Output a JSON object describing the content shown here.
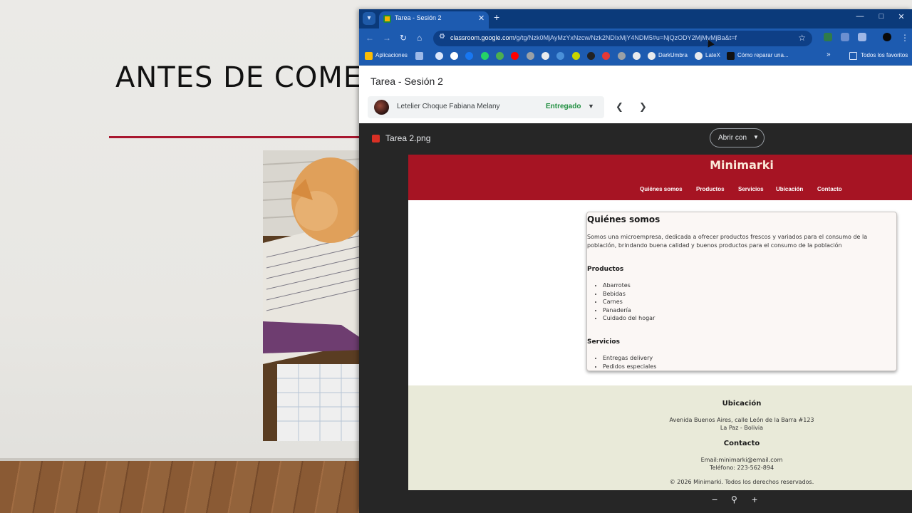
{
  "slide": {
    "title": "ANTES DE COMEN",
    "accent_color": "#a8162e"
  },
  "browser": {
    "tab": {
      "title": "Tarea - Sesión 2"
    },
    "address": {
      "host": "classroom.google.com",
      "path": "/g/tg/Nzk0MjAyMzYxNzcw/Nzk2NDIxMjY4NDM5#u=NjQzODY2MjMyMjBa&t=f"
    },
    "bookmarks": {
      "apps_label": "Aplicaciones",
      "items": [
        "DarkUmbra",
        "LateX",
        "Cómo reparar una..."
      ],
      "all_label": "Todos los favoritos"
    }
  },
  "classroom": {
    "title": "Tarea - Sesión 2",
    "student_name": "Letelier Choque Fabiana Melany",
    "status": "Entregado",
    "file_name": "Tarea 2.png",
    "open_with_label": "Abrir con"
  },
  "minimarki": {
    "brand": "Minimarki",
    "nav": [
      "Quiénes somos",
      "Productos",
      "Servicios",
      "Ubicación",
      "Contacto"
    ],
    "about_title": "Quiénes somos",
    "about_text": "Somos una microempresa, dedicada a ofrecer productos frescos y variados para el consumo de la población, brindando buena calidad y buenos productos para el consumo de la población",
    "products_title": "Productos",
    "products": [
      "Abarrotes",
      "Bebidas",
      "Carnes",
      "Panadería",
      "Cuidado del hogar"
    ],
    "services_title": "Servicios",
    "services": [
      "Entregas delivery",
      "Pedidos especiales"
    ],
    "footer": {
      "location_title": "Ubicación",
      "address_line1": "Avenida Buenos Aires, calle León de la Barra #123",
      "address_line2": "La Paz - Bolivia",
      "contact_title": "Contacto",
      "email": "Email:minimarki@email.com",
      "phone": "Teléfono: 223-562-894",
      "copyright": "© 2026 Minimarki. Todos los derechos reservados."
    },
    "colors": {
      "header": "#a61423",
      "footer": "#e9ead9"
    }
  },
  "icons": {
    "tab_menu": "chevron-down-icon",
    "back": "arrow-left-icon",
    "forward": "arrow-right-icon",
    "reload": "reload-icon",
    "home": "home-icon",
    "star": "star-icon",
    "prev": "chevron-left-icon",
    "next": "chevron-right-icon",
    "zoom_out": "minus-icon",
    "zoom": "magnifier-icon",
    "zoom_in": "plus-icon"
  }
}
